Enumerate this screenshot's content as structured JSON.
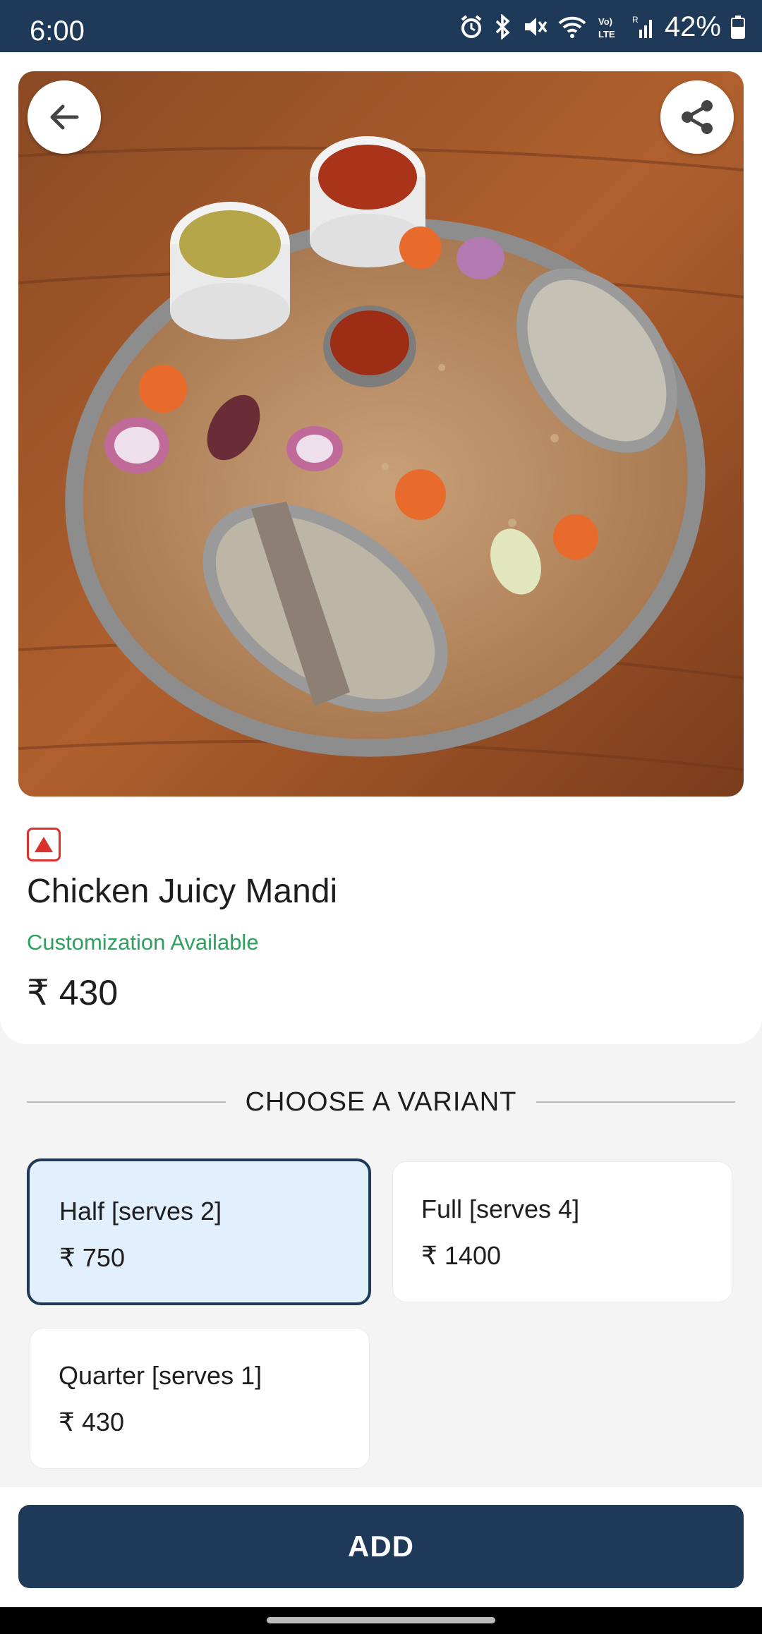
{
  "status_bar": {
    "time": "6:00",
    "battery": "42%",
    "icons": [
      "alarm-icon",
      "bluetooth-icon",
      "mute-icon",
      "wifi-icon",
      "volte-icon",
      "signal-icon",
      "battery-icon"
    ]
  },
  "header": {
    "back_icon": "arrow-left-icon",
    "share_icon": "share-icon"
  },
  "item": {
    "diet_mark": "non-veg-icon",
    "title": "Chicken Juicy Mandi",
    "customization": "Customization Available",
    "price": "₹ 430"
  },
  "variants": {
    "heading": "CHOOSE A VARIANT",
    "selected_index": 0,
    "options": [
      {
        "name": "Half [serves 2]",
        "price": "₹ 750"
      },
      {
        "name": "Full [serves 4]",
        "price": "₹ 1400"
      },
      {
        "name": "Quarter [serves 1]",
        "price": "₹ 430"
      }
    ]
  },
  "actions": {
    "add_label": "ADD"
  },
  "colors": {
    "primary": "#1f3a58",
    "accent_green": "#2ea15f",
    "nonveg_red": "#d9322d",
    "selected_bg": "#e2effc"
  }
}
